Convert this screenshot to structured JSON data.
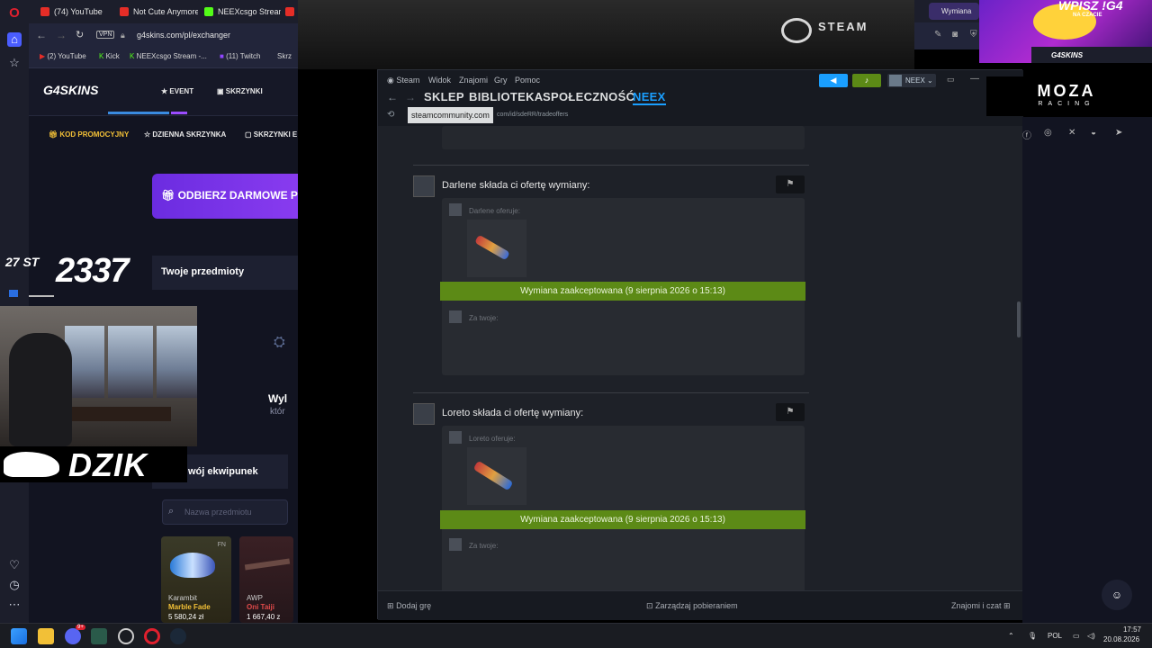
{
  "opera_tabs": [
    {
      "label": "(74) YouTube",
      "color": "#e52d27"
    },
    {
      "label": "Not Cute Anymore",
      "color": "#e52d27"
    },
    {
      "label": "NEEXcsgo Stream",
      "color": "#53fc18"
    }
  ],
  "left_browser": {
    "url": "g4skins.com/pl/exchanger",
    "vpn": "VPN",
    "bookmarks": [
      "(2) YouTube",
      "Kick",
      "NEEXcsgo Stream -...",
      "(11) Twitch",
      "Skrz"
    ],
    "site": {
      "logo": "G4SKINS",
      "nav": [
        "EVENT",
        "SKRZYNKI"
      ],
      "subnav": [
        "KOD PROMOCYJNY",
        "DZIENNA SKRZYNKA",
        "SKRZYNKI E"
      ],
      "promo_button": "ODBIERZ DARMOWE P",
      "items_title": "Twoje przedmioty",
      "wyl_text": "Wyl",
      "ktor_text": "któr",
      "inventory_title": "wój ekwipunek",
      "search_placeholder": "Nazwa przedmiotu",
      "cards": [
        {
          "badge": "FN",
          "type": "Karambit",
          "name": "Marble Fade",
          "price": "5 580,24 zł",
          "accent": "#c9a227"
        },
        {
          "badge": "",
          "type": "AWP",
          "name": "Oni Taiji",
          "price": "1 667,40 z",
          "accent": "#c33a3a"
        }
      ]
    }
  },
  "overlay": {
    "counter_small": "27 ST",
    "counter": "2337",
    "brand": "DZIK"
  },
  "steam_logo": "STEAM",
  "steam": {
    "menus": [
      "Steam",
      "Widok",
      "Znajomi",
      "Gry",
      "Pomoc"
    ],
    "nav": [
      "SKLEP",
      "BIBLIOTEKA",
      "SPOŁECZNOŚĆ",
      "NEEX"
    ],
    "account": "NEEX",
    "tooltip": "steamcommunity.com",
    "url_tail": "com/id/sdeRR/tradeoffers",
    "offers": [
      {
        "title": "Darlene składa ci ofertę wymiany:",
        "offers_label": "Darlene oferuje:",
        "accepted": "Wymiana zaakceptowana (9 sierpnia 2026 o 15:13)",
        "yours": "Za twoje:"
      },
      {
        "title": "Loreto składa ci ofertę wymiany:",
        "offers_label": "Loreto oferuje:",
        "accepted": "Wymiana zaakceptowana (9 sierpnia 2026 o 15:13)",
        "yours": "Za twoje:"
      }
    ],
    "bottom": {
      "add_game": "Dodaj grę",
      "downloads": "Zarządzaj pobieraniem",
      "friends": "Znajomi i czat"
    }
  },
  "right": {
    "tab": "Wymiana",
    "ad_title": "WPISZ !G4",
    "ad_sub": "NA CZACIE",
    "ad_brand": "G4SKINS",
    "moza": "MOZA",
    "moza_sub": "RACING"
  },
  "taskbar": {
    "lang": "POL",
    "time": "17:57",
    "date": "20.08.2026",
    "discord_badge": "9+"
  }
}
